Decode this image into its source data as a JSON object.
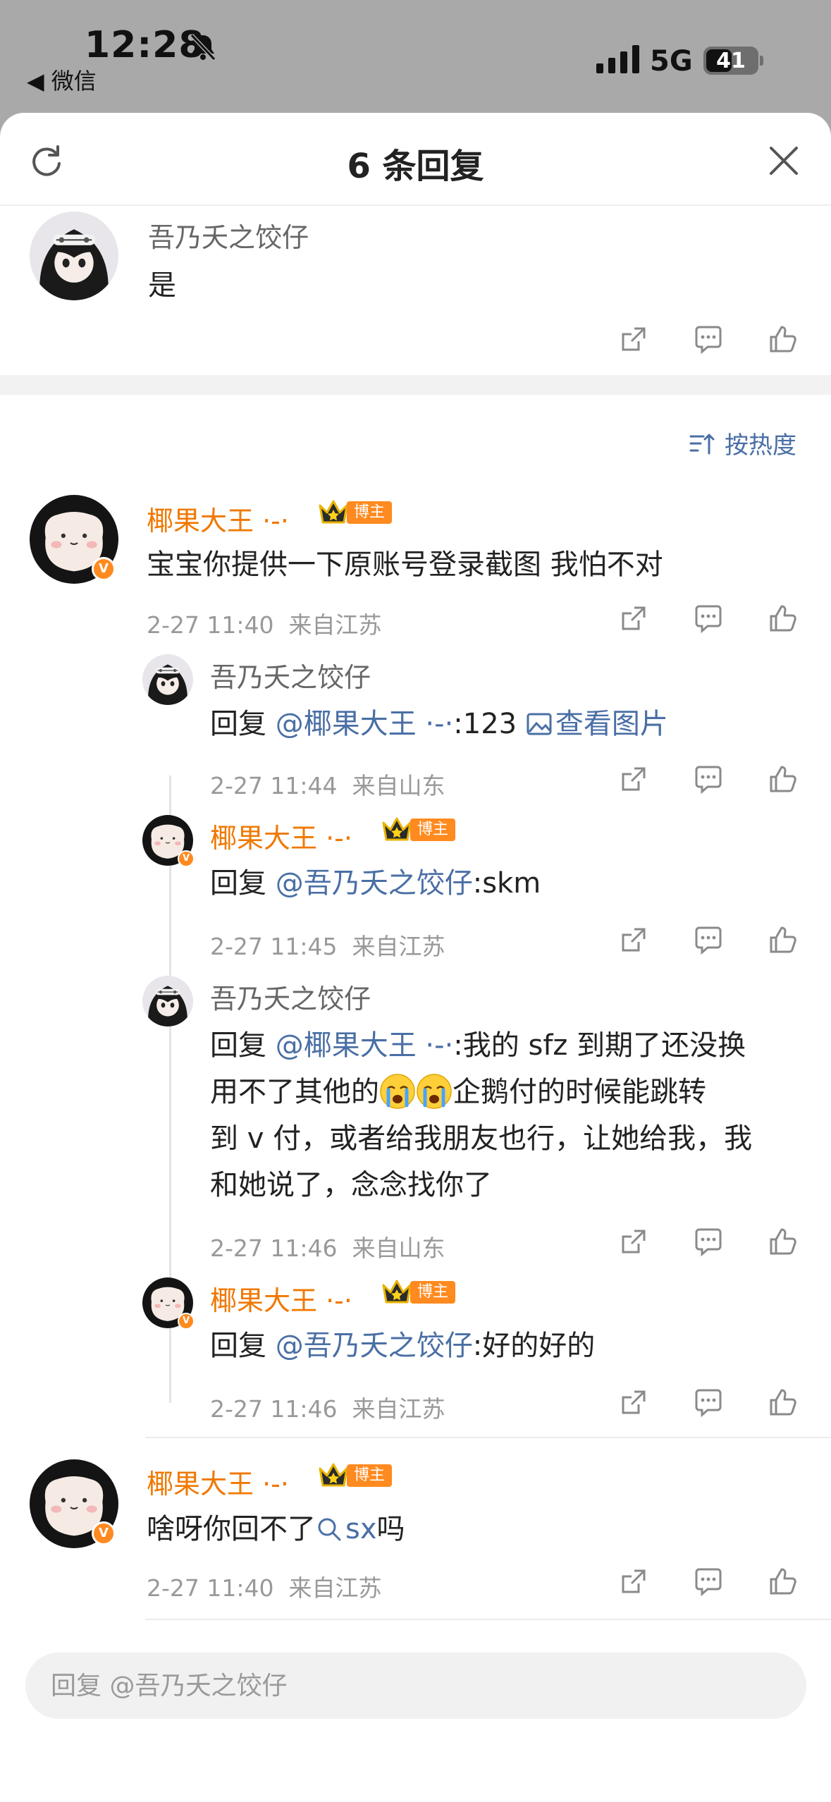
{
  "status_bar": {
    "time": "12:28",
    "back_app": "◀ 微信",
    "network": "5G",
    "battery": "41"
  },
  "sheet": {
    "title": "6 条回复",
    "sort_label": "按热度"
  },
  "parent_comment": {
    "user": "吾乃夭之饺仔",
    "text": "是"
  },
  "badge_label": "博主",
  "verified_mark": "V",
  "comments": [
    {
      "user": "椰果大王 ·-·",
      "text": "宝宝你提供一下原账号登录截图 我怕不对",
      "time": "2-27 11:40",
      "location": "来自江苏"
    },
    {
      "user": "吾乃夭之饺仔",
      "prefix": "回复 ",
      "mention": "@椰果大王 ·-·",
      "text": ":123 ",
      "link": "查看图片",
      "time": "2-27 11:44",
      "location": "来自山东"
    },
    {
      "user": "椰果大王 ·-·",
      "prefix": "回复 ",
      "mention": "@吾乃夭之饺仔",
      "text": ":skm",
      "time": "2-27 11:45",
      "location": "来自江苏"
    },
    {
      "user": "吾乃夭之饺仔",
      "prefix": "回复 ",
      "mention": "@椰果大王 ·-·",
      "line1": ":我的 sfz 到期了还没换",
      "line2a": "用不了其他的",
      "line2b": "企鹅付的时候能跳转",
      "line3": "到 v 付，或者给我朋友也行，让她给我，我",
      "line4": "和她说了，念念找你了",
      "time": "2-27 11:46",
      "location": "来自山东"
    },
    {
      "user": "椰果大王 ·-·",
      "prefix": "回复 ",
      "mention": "@吾乃夭之饺仔",
      "text": ":好的好的",
      "time": "2-27 11:46",
      "location": "来自江苏"
    },
    {
      "user": "椰果大王 ·-·",
      "text_a": "啥呀你回不了",
      "search_link": "sx",
      "text_b": "吗",
      "time": "2-27 11:40",
      "location": "来自江苏"
    }
  ],
  "input": {
    "placeholder": "回复 @吾乃夭之饺仔"
  },
  "icons": [
    "bell-muted-icon",
    "signal-icon",
    "refresh-icon",
    "close-icon",
    "share-icon",
    "comment-icon",
    "like-icon",
    "sort-icon",
    "image-icon",
    "search-icon",
    "crown-icon",
    "crying-emoji"
  ],
  "colors": {
    "accent_orange": "#f07800",
    "mention_blue": "#4a6fa5",
    "meta_gray": "#999999"
  }
}
